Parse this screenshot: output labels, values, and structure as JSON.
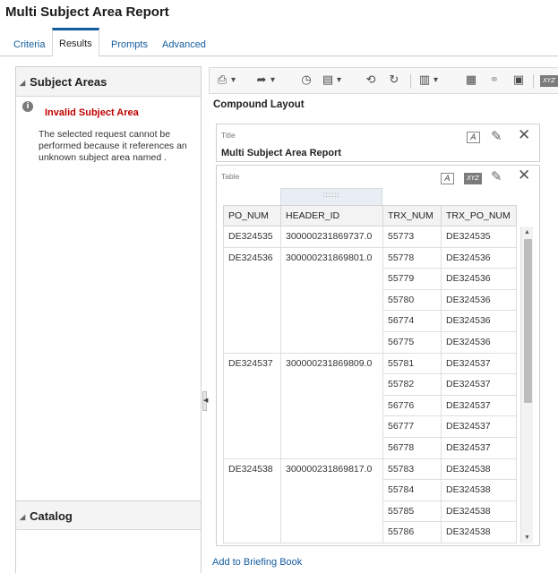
{
  "app": {
    "title": "Multi Subject Area Report"
  },
  "tabs": [
    {
      "label": "Criteria",
      "active": false
    },
    {
      "label": "Results",
      "active": true
    },
    {
      "label": "Prompts",
      "active": false
    },
    {
      "label": "Advanced",
      "active": false
    }
  ],
  "left_panel": {
    "subject_areas": {
      "heading": "Subject Areas",
      "error_title": "Invalid Subject Area",
      "error_message": "The selected request cannot be performed because it references an unknown subject area named ."
    },
    "catalog": {
      "heading": "Catalog"
    }
  },
  "toolbar": {
    "icons": [
      "print-icon",
      "export-icon",
      "schedule-icon",
      "print-preview-icon",
      "refresh-icon",
      "reload-icon",
      "new-view-icon",
      "remove-icon",
      "merge-icon",
      "properties-icon",
      "xyz-icon"
    ]
  },
  "compound_layout": {
    "title": "Compound Layout",
    "title_view": {
      "label": "Title",
      "text": "Multi Subject Area Report"
    },
    "table_view": {
      "label": "Table",
      "grip": "::::::",
      "columns": [
        "PO_NUM",
        "HEADER_ID",
        "TRX_NUM",
        "TRX_PO_NUM"
      ],
      "rows": [
        [
          "DE324535",
          "300000231869737.0",
          "55773",
          "DE324535"
        ],
        [
          "DE324536",
          "300000231869801.0",
          "55778",
          "DE324536"
        ],
        [
          "",
          "",
          "55779",
          "DE324536"
        ],
        [
          "",
          "",
          "55780",
          "DE324536"
        ],
        [
          "",
          "",
          "56774",
          "DE324536"
        ],
        [
          "",
          "",
          "56775",
          "DE324536"
        ],
        [
          "DE324537",
          "300000231869809.0",
          "55781",
          "DE324537"
        ],
        [
          "",
          "",
          "55782",
          "DE324537"
        ],
        [
          "",
          "",
          "56776",
          "DE324537"
        ],
        [
          "",
          "",
          "56777",
          "DE324537"
        ],
        [
          "",
          "",
          "56778",
          "DE324537"
        ],
        [
          "DE324538",
          "300000231869817.0",
          "55783",
          "DE324538"
        ],
        [
          "",
          "",
          "55784",
          "DE324538"
        ],
        [
          "",
          "",
          "55785",
          "DE324538"
        ],
        [
          "",
          "",
          "55786",
          "DE324538"
        ]
      ]
    }
  },
  "footer": {
    "briefing_link": "Add to Briefing Book"
  }
}
